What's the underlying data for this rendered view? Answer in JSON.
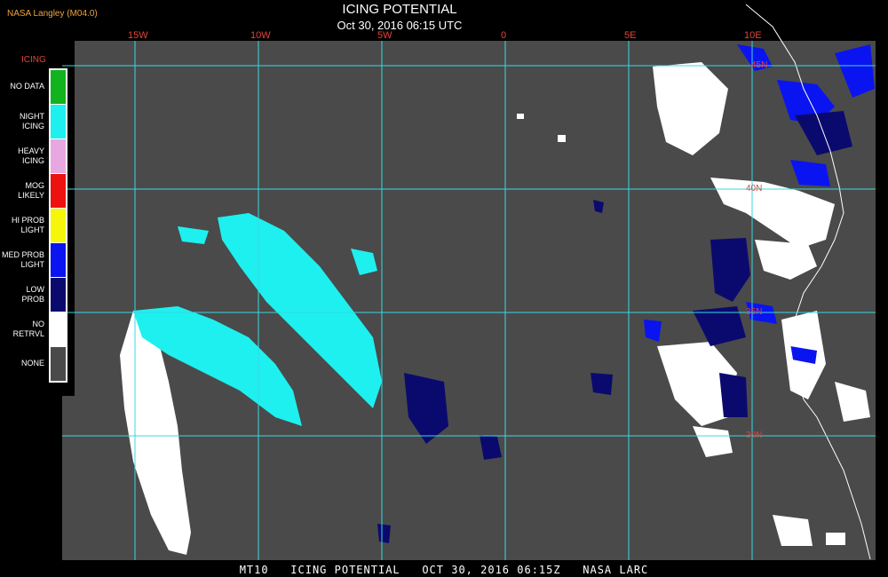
{
  "header": {
    "credit": "NASA Langley (M04.0)",
    "title": "ICING POTENTIAL",
    "subtitle": "Oct 30, 2016 06:15 UTC"
  },
  "footer": {
    "text": "MT10   ICING POTENTIAL   OCT 30, 2016 06:15Z   NASA LARC"
  },
  "legend": {
    "title": "ICING",
    "items": [
      {
        "label_line1": "NO DATA",
        "label_line2": "",
        "color": "#11b41e"
      },
      {
        "label_line1": "NIGHT",
        "label_line2": "ICING",
        "color": "#1ef0f0"
      },
      {
        "label_line1": "HEAVY",
        "label_line2": "ICING",
        "color": "#e7a8e1"
      },
      {
        "label_line1": "MOG",
        "label_line2": "LIKELY",
        "color": "#ee1111"
      },
      {
        "label_line1": "HI PROB",
        "label_line2": "LIGHT",
        "color": "#f6f60a"
      },
      {
        "label_line1": "MED PROB",
        "label_line2": "LIGHT",
        "color": "#0a14f0"
      },
      {
        "label_line1": "LOW",
        "label_line2": "PROB",
        "color": "#0a0a6e"
      },
      {
        "label_line1": "NO",
        "label_line2": "RETRVL",
        "color": "#ffffff"
      },
      {
        "label_line1": "NONE",
        "label_line2": "",
        "color": "#4a4a4a"
      }
    ]
  },
  "map": {
    "background_color": "#4a4a4a",
    "grid_color": "#37d9e3",
    "label_color": "#e2443a",
    "longitude_labels": [
      "15W",
      "10W",
      "5W",
      "0",
      "5E",
      "10E"
    ],
    "latitude_labels": [
      "45N",
      "40N",
      "35N",
      "30N"
    ]
  }
}
